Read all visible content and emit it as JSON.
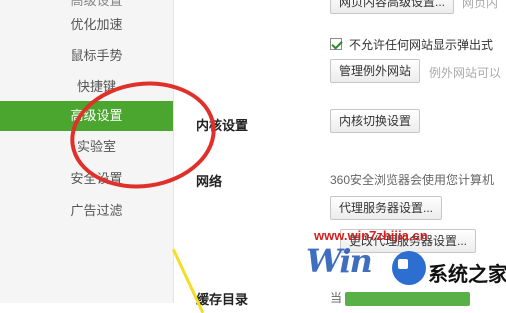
{
  "sidebar": {
    "items": [
      {
        "label": "高级设置"
      },
      {
        "label": "优化加速"
      },
      {
        "label": "鼠标手势"
      },
      {
        "label": "快捷键"
      },
      {
        "label": "高级设置"
      },
      {
        "label": "实验室"
      },
      {
        "label": "安全设置"
      },
      {
        "label": "广告过滤"
      }
    ],
    "active_index": 4
  },
  "top": {
    "partial_button": "网页内容高级设置...",
    "partial_tail": "网页内"
  },
  "popup": {
    "checkbox_label": "不允许任何网站显示弹出式",
    "checked": true,
    "manage_button": "管理例外网站",
    "manage_note": "例外网站可以"
  },
  "kernel": {
    "label": "内核设置",
    "button": "内核切换设置"
  },
  "network": {
    "label": "网络",
    "description": "360安全浏览器会使用您计算机",
    "proxy_button": "代理服务器设置...",
    "change_proxy_button": "更改代理服务器设置..."
  },
  "cache": {
    "label": "缓存目录",
    "partial_text": "当"
  },
  "watermark": {
    "url": "www.win7zhijia.cn",
    "logo": "Win",
    "brand": "系统之家"
  },
  "colors": {
    "accent_green": "#4aa62f",
    "highlight_red": "#e0302a",
    "arrow_yellow": "#f4dd25"
  }
}
